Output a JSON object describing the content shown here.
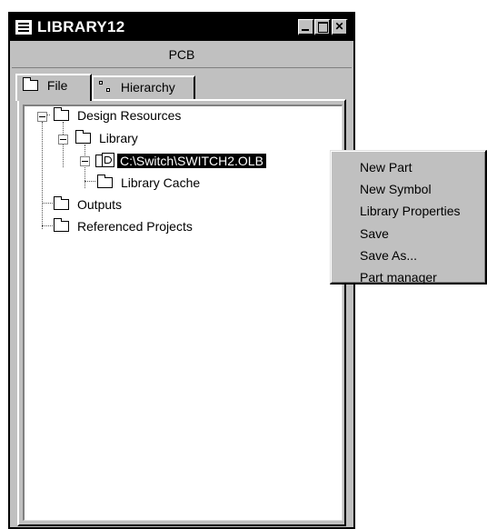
{
  "window": {
    "title": "LIBRARY12"
  },
  "header": {
    "label": "PCB"
  },
  "tabs": [
    {
      "label": "File",
      "icon": "folder-icon"
    },
    {
      "label": "Hierarchy",
      "icon": "hierarchy-icon"
    }
  ],
  "tree": {
    "design_resources": "Design Resources",
    "library": "Library",
    "library_file": "C:\\Switch\\SWITCH2.OLB",
    "library_cache": "Library Cache",
    "outputs": "Outputs",
    "referenced_projects": "Referenced Projects"
  },
  "context_menu": {
    "items": [
      "New Part",
      "New Symbol",
      "Library Properties",
      "Save",
      "Save As...",
      "Part manager"
    ]
  }
}
